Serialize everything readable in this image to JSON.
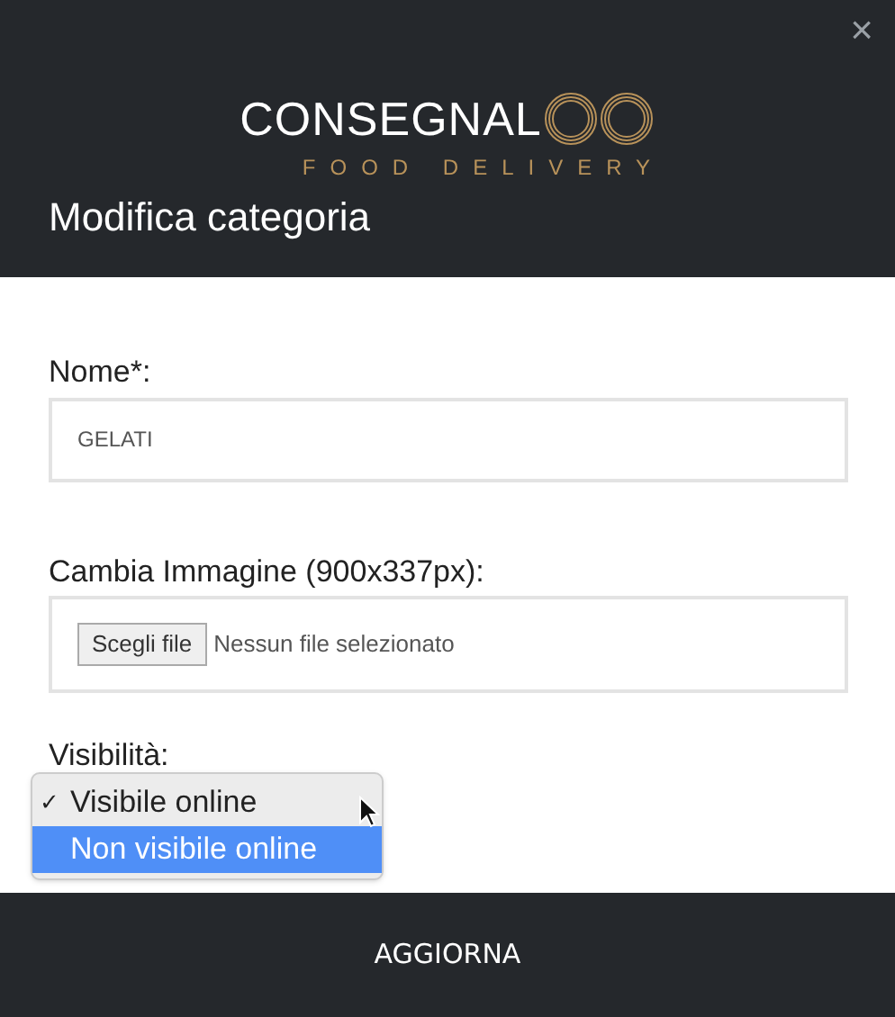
{
  "header": {
    "close": "×",
    "logo": {
      "wordmark": "CONSEGNAL",
      "tagline": "FOOD DELIVERY"
    },
    "title": "Modifica categoria"
  },
  "form": {
    "name": {
      "label": "Nome*:",
      "value": "GELATI"
    },
    "image": {
      "label": "Cambia Immagine (900x337px):",
      "button": "Scegli file",
      "status": "Nessun file selezionato"
    },
    "visibility": {
      "label": "Visibilità:",
      "check": "✓",
      "options": [
        {
          "label": "Visibile online",
          "selected": true,
          "highlighted": false
        },
        {
          "label": "Non visibile online",
          "selected": false,
          "highlighted": true
        }
      ]
    }
  },
  "footer": {
    "button": "AGGIORNA"
  }
}
